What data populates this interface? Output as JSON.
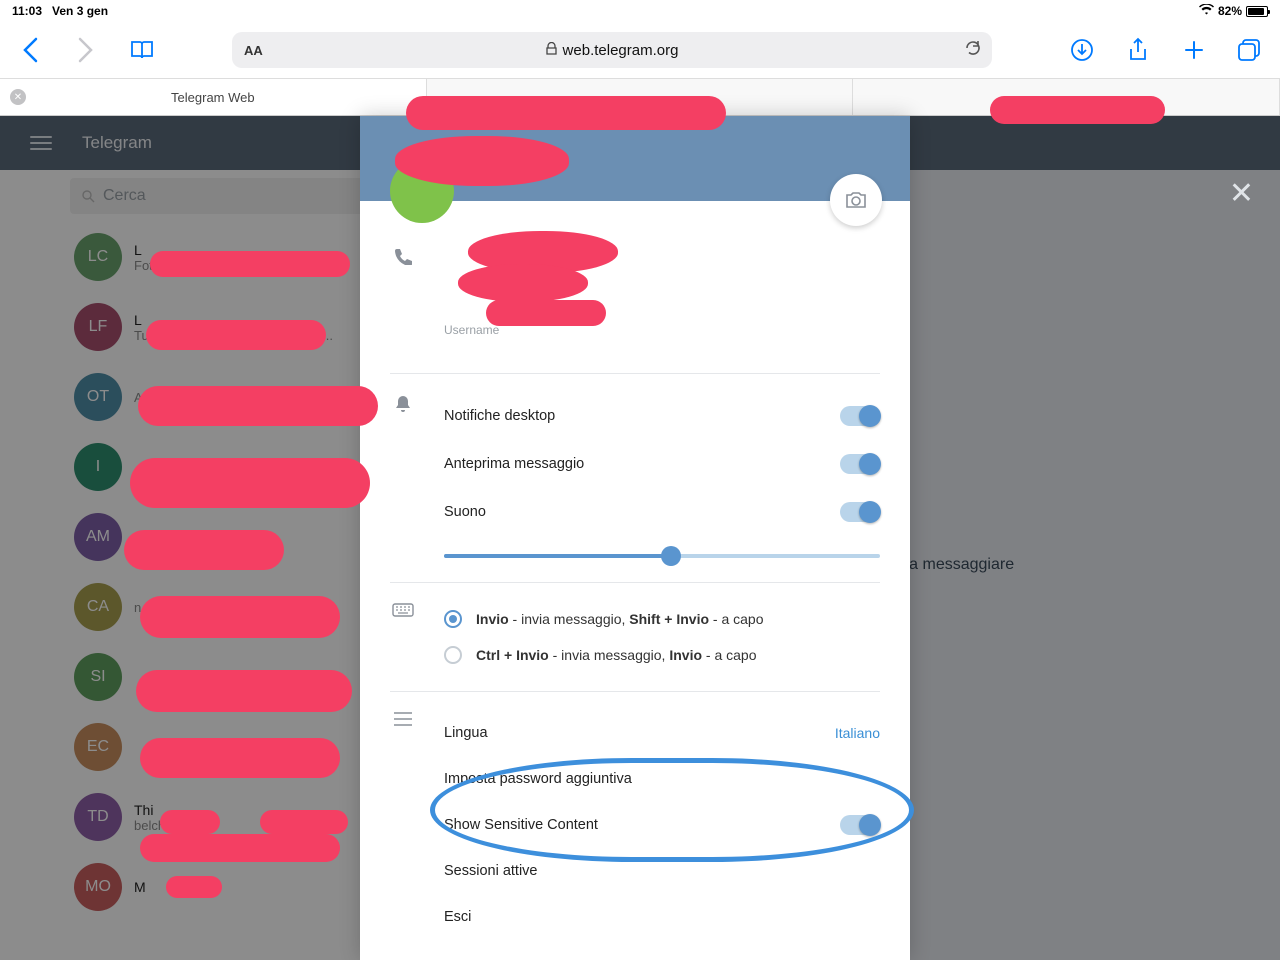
{
  "status": {
    "time": "11:03",
    "date": "Ven 3 gen",
    "battery": "82%"
  },
  "safari": {
    "url_host": "web.telegram.org"
  },
  "tabs": {
    "active": "Telegram Web"
  },
  "telegram": {
    "title": "Telegram",
    "search_placeholder": "Cerca",
    "chat_hint": "Seleziona una chat per iniziare a messaggiare",
    "chats": [
      {
        "initials": "LC",
        "color": "#6aa36d",
        "name": "L",
        "preview": "Foto"
      },
      {
        "initials": "LF",
        "color": "#a84f6e",
        "name": "L",
        "preview": "Tu: Però aprendolo dal web ho tr..."
      },
      {
        "initials": "OT",
        "color": "#4f8fa8",
        "name": "",
        "preview": "A"
      },
      {
        "initials": "I",
        "color": "#2f8f6f",
        "name": "",
        "preview": ""
      },
      {
        "initials": "AM",
        "color": "#7f5fa8",
        "name": "",
        "preview": ""
      },
      {
        "initials": "CA",
        "color": "#a89f4f",
        "name": "",
        "preview": "n"
      },
      {
        "initials": "SI",
        "color": "#5f9f5f",
        "name": "",
        "preview": ""
      },
      {
        "initials": "EC",
        "color": "#c98f5f",
        "name": "",
        "preview": ""
      },
      {
        "initials": "TD",
        "color": "#8f5fa8",
        "name": "Thi",
        "preview": "belche"
      },
      {
        "initials": "MO",
        "color": "#c95f5f",
        "name": "M",
        "preview": ""
      }
    ]
  },
  "settings": {
    "username_label": "Username",
    "notifications": {
      "desktop": "Notifiche desktop",
      "preview": "Anteprima messaggio",
      "sound": "Suono"
    },
    "send": {
      "opt1_bold1": "Invio",
      "opt1_mid": " - invia messaggio, ",
      "opt1_bold2": "Shift + Invio",
      "opt1_end": " - a capo",
      "opt2_bold1": "Ctrl + Invio",
      "opt2_mid": " - invia messaggio, ",
      "opt2_bold2": "Invio",
      "opt2_end": " - a capo"
    },
    "language_label": "Lingua",
    "language_value": "Italiano",
    "additional_password": "Imposta password aggiuntiva",
    "sensitive": "Show Sensitive Content",
    "sessions": "Sessioni attive",
    "logout": "Esci"
  }
}
